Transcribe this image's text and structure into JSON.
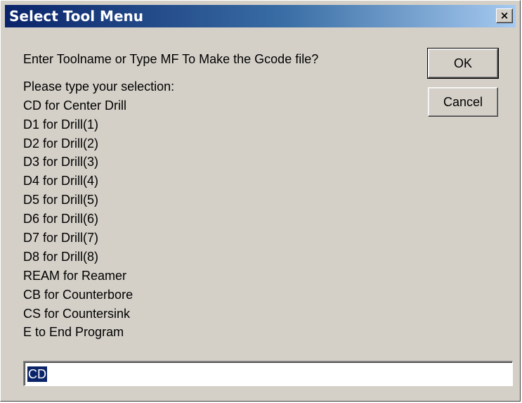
{
  "window": {
    "title": "Select Tool Menu",
    "close_label": "×"
  },
  "prompt": {
    "question": "Enter Toolname or Type MF To Make the Gcode file?",
    "instruction": "Please type your selection:",
    "options": [
      "CD for Center Drill",
      "D1 for Drill(1)",
      "D2 for Drill(2)",
      "D3 for Drill(3)",
      "D4 for Drill(4)",
      "D5 for Drill(5)",
      "D6 for Drill(6)",
      "D7 for Drill(7)",
      "D8 for Drill(8)",
      "REAM for Reamer",
      "CB for Counterbore",
      "CS for Countersink",
      "E to End Program"
    ]
  },
  "buttons": {
    "ok": "OK",
    "cancel": "Cancel"
  },
  "input": {
    "value": "CD"
  },
  "colors": {
    "dialog_bg": "#d4d0c8",
    "title_start": "#0a246a",
    "title_end": "#a6caf0",
    "selection": "#0a246a"
  }
}
